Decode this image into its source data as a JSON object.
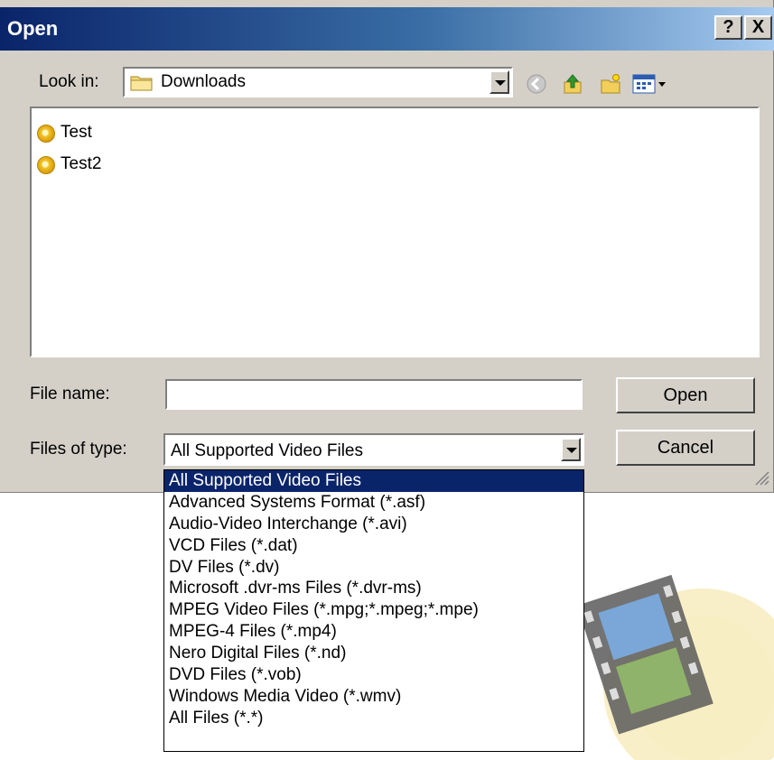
{
  "window": {
    "title": "Open"
  },
  "title_buttons": {
    "help": "?",
    "close": "X"
  },
  "look_in": {
    "label": "Look in:",
    "value": "Downloads"
  },
  "toolbar": {
    "icons": [
      "back-icon",
      "up-folder-icon",
      "new-folder-icon",
      "view-menu-icon"
    ]
  },
  "files": [
    {
      "name": "Test"
    },
    {
      "name": "Test2"
    }
  ],
  "file_name": {
    "label": "File name:",
    "value": ""
  },
  "files_of_type": {
    "label": "Files of type:",
    "value": "All Supported Video Files"
  },
  "buttons": {
    "open": "Open",
    "cancel": "Cancel"
  },
  "type_options": [
    "All Supported Video Files",
    "Advanced Systems Format (*.asf)",
    "Audio-Video Interchange (*.avi)",
    "VCD Files (*.dat)",
    "DV Files (*.dv)",
    "Microsoft .dvr-ms Files (*.dvr-ms)",
    "MPEG Video Files (*.mpg;*.mpeg;*.mpe)",
    "MPEG-4 Files (*.mp4)",
    "Nero Digital Files (*.nd)",
    "DVD Files (*.vob)",
    "Windows Media Video (*.wmv)",
    "All Files (*.*)"
  ],
  "selected_option_index": 0,
  "colors": {
    "titlebar_start": "#0a246a",
    "titlebar_end": "#a6caf0",
    "selection": "#0a246a",
    "dialog_face": "#d4d0c8"
  }
}
